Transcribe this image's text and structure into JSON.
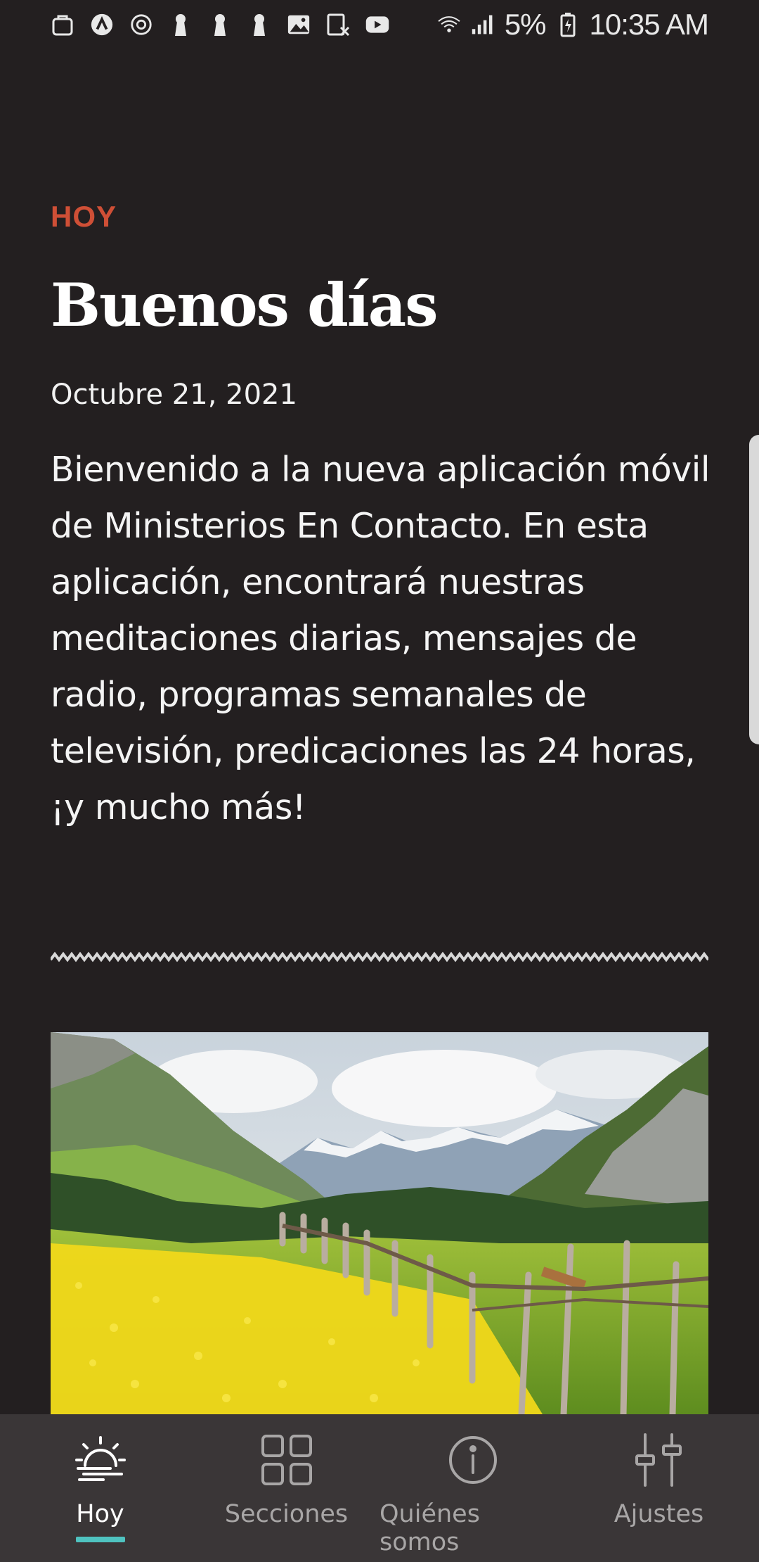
{
  "status_bar": {
    "left_icons": [
      "bag-icon",
      "assistant-icon",
      "sync-icon",
      "keyhole-icon",
      "keyhole-icon",
      "keyhole-icon",
      "image-icon",
      "no-sim-icon",
      "youtube-icon"
    ],
    "battery_percent": "5%",
    "time": "10:35 AM"
  },
  "main": {
    "section_label": "HOY",
    "greeting": "Buenos días",
    "date": "Octubre 21, 2021",
    "intro": "Bienvenido a la nueva aplicación móvil de Ministerios En Contacto. En esta aplicación,  encontrará nuestras meditaciones diarias, mensajes de radio, programas semanales de televisión, predicaciones las 24 horas, ¡y mucho más!"
  },
  "bottom_nav": {
    "items": [
      {
        "label": "Hoy",
        "icon": "sun-icon",
        "active": true
      },
      {
        "label": "Secciones",
        "icon": "grid-icon",
        "active": false
      },
      {
        "label": "Quiénes somos",
        "icon": "info-icon",
        "active": false
      },
      {
        "label": "Ajustes",
        "icon": "sliders-icon",
        "active": false
      }
    ]
  },
  "colors": {
    "background": "#231f20",
    "accent_label": "#cf4f36",
    "nav_background": "#3a3637",
    "active_indicator": "#4fc3c0"
  }
}
